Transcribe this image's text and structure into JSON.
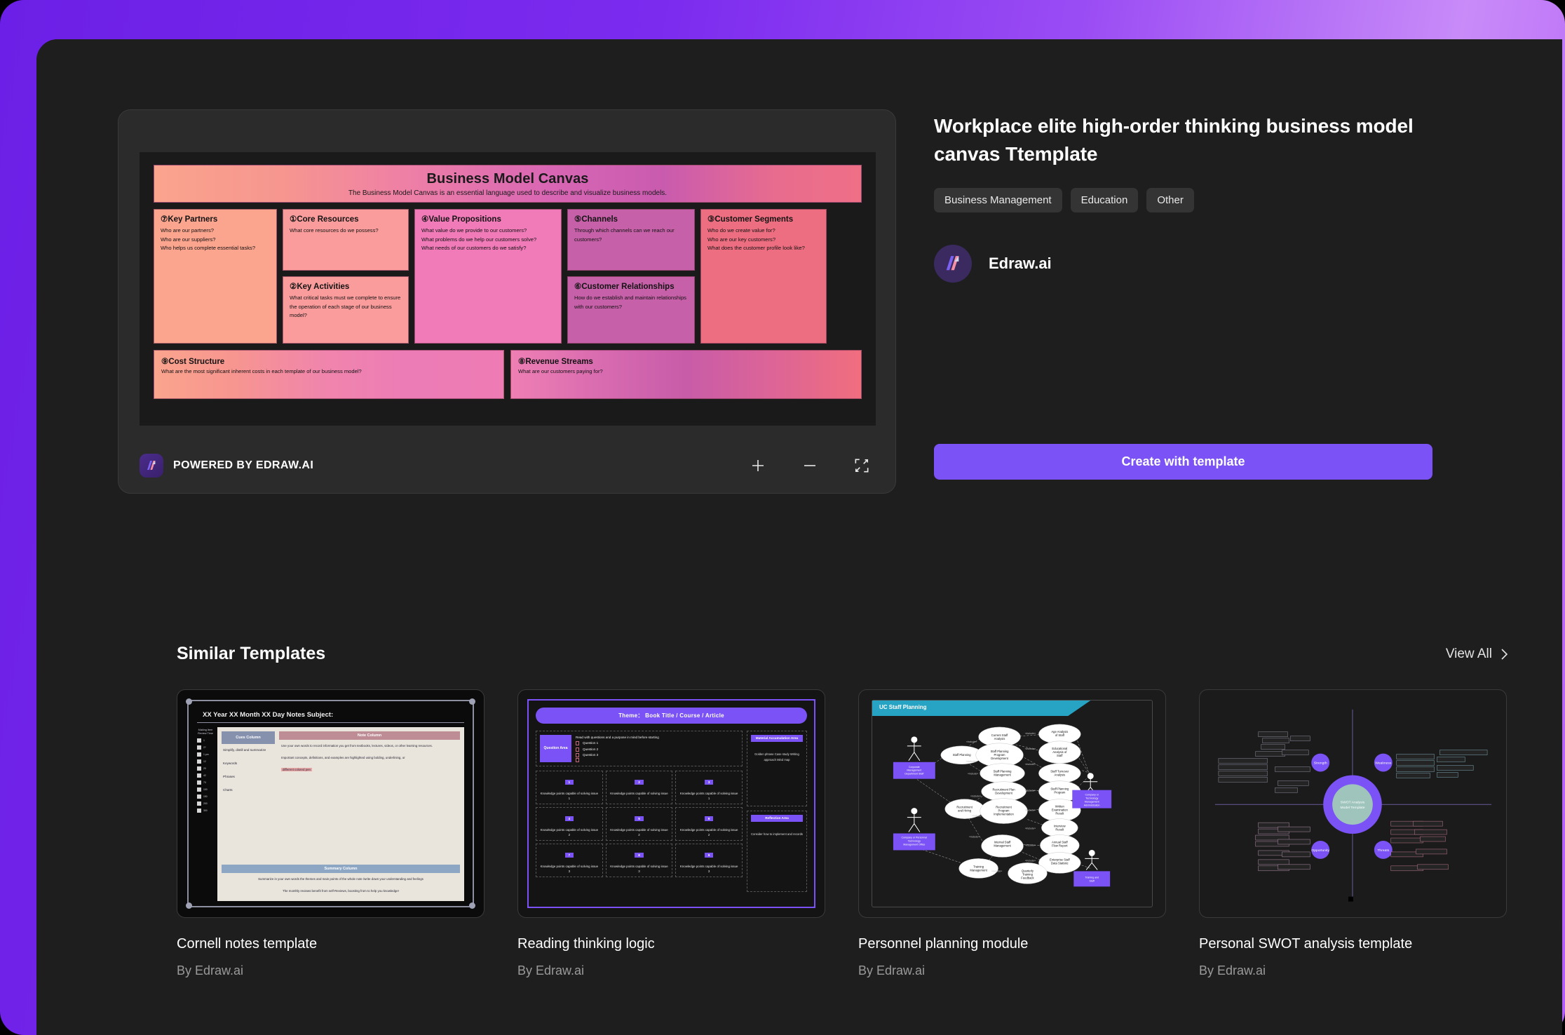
{
  "template": {
    "title": "Workplace elite high-order thinking business model canvas Ttemplate",
    "tags": [
      "Business Management",
      "Education",
      "Other"
    ],
    "author": "Edraw.ai",
    "cta_label": "Create with template"
  },
  "preview": {
    "watermark": "POWERED BY EDRAW.AI",
    "zoom_in": "+",
    "zoom_out": "−",
    "fullscreen_label": "Fullscreen"
  },
  "canvas": {
    "header_title": "Business Model Canvas",
    "header_subtitle": "The Business Model Canvas is an essential language used to describe and visualize business models.",
    "blocks": [
      {
        "num": "⑦",
        "title": "Key Partners",
        "lines": [
          "Who are our partners?",
          "Who are our suppliers?",
          "Who helps us complete essential tasks?"
        ]
      },
      {
        "num": "①",
        "title": "Core Resources",
        "lines": [
          "What core resources do we possess?"
        ]
      },
      {
        "num": "②",
        "title": "Key Activities",
        "lines": [
          "What critical tasks must we complete to ensure the operation of each stage of our business model?"
        ]
      },
      {
        "num": "④",
        "title": "Value Propositions",
        "lines": [
          "What value do we provide to our customers?",
          "What problems do we help our customers solve?",
          "What needs of our customers do we satisfy?"
        ]
      },
      {
        "num": "⑤",
        "title": "Channels",
        "lines": [
          "Through which channels can we reach our customers?"
        ]
      },
      {
        "num": "⑥",
        "title": "Customer Relationships",
        "lines": [
          "How do we establish and maintain relationships with our customers?"
        ]
      },
      {
        "num": "③",
        "title": "Customer Segments",
        "lines": [
          "Who do we create value for?",
          "Who are our key customers?",
          "What does the customer profile look like?"
        ]
      },
      {
        "num": "⑨",
        "title": "Cost Structure",
        "lines": [
          "What are the most significant inherent costs in each template of our business model?"
        ]
      },
      {
        "num": "⑧",
        "title": "Revenue Streams",
        "lines": [
          "What are our customers paying for?"
        ]
      }
    ]
  },
  "similar": {
    "heading": "Similar Templates",
    "view_all": "View All",
    "cards": [
      {
        "title": "Cornell notes template",
        "by": "By Edraw.ai"
      },
      {
        "title": "Reading thinking logic",
        "by": "By Edraw.ai"
      },
      {
        "title": "Personnel planning module",
        "by": "By Edraw.ai"
      },
      {
        "title": "Personal SWOT analysis template",
        "by": "By Edraw.ai"
      }
    ]
  },
  "thumb_cornell": {
    "header": "XX Year XX Month XX Day     Notes Subject:",
    "rail_label": "Making Item Review Time",
    "rail_rows": [
      "1",
      "2?",
      "1 pm",
      "12",
      "20",
      "42",
      "70",
      "100",
      "150",
      "200",
      "300"
    ],
    "cues_header": "Cues Column",
    "cues_body": "Simplify, distill and summarize",
    "cues_items": [
      "Keywords",
      "Phrases",
      "Charts"
    ],
    "note_header": "Note Column",
    "note_body": "Use your own words to record information you get from textbooks, lectures, videos, or other learning resources.",
    "note_body2": "Important concepts, definitions, and examples are highlighted using bolding, underlining, or",
    "note_hl": "different colored pen",
    "summary_header": "Summary Column",
    "summary_body": "Summarize in your own words the themes and main points of the whole note /write down your understanding and feelings",
    "summary_note": "The monthly reviews benefit from self-Reviews, boosting from to help you knowledge!"
  },
  "thumb_reading": {
    "theme": "Theme： Book Title / Course / Article",
    "question_area": "Question Area",
    "read_prompt": "Read with questions and a purpose in mind before starting",
    "questions": [
      "Question 1",
      "Question 2",
      "Question 3"
    ],
    "cells": [
      {
        "num": "1",
        "text": "Knowledge points capable of solving issue 1"
      },
      {
        "num": "2",
        "text": "Knowledge points capable of solving issue 1"
      },
      {
        "num": "3",
        "text": "Knowledge points capable of solving issue 1"
      },
      {
        "num": "4",
        "text": "Knowledge points capable of solving issue 2"
      },
      {
        "num": "5",
        "text": "Knowledge points capable of solving issue 2"
      },
      {
        "num": "6",
        "text": "Knowledge points capable of solving issue 2"
      },
      {
        "num": "7",
        "text": "Knowledge points capable of solving issue 3"
      },
      {
        "num": "8",
        "text": "Knowledge points capable of solving issue 3"
      },
      {
        "num": "9",
        "text": "Knowledge points capable of solving issue 3"
      }
    ],
    "material_header": "Material Accumulation Area",
    "material_body": "Golden phrase Case study Writing approach Mind map",
    "reflection_header": "Reflection Area",
    "reflection_body": "Consider how to implement and records"
  },
  "thumb_usecase": {
    "title": "UC Staff Planning",
    "actors": [
      "Corporate Management Department Staff",
      "Company or Personnel Technology Management Office",
      "Training and Staff"
    ],
    "usecases": [
      "Staff Planning",
      "Current Staff Analysis",
      "Age Analysis of Staff",
      "Staff Planning Program Development",
      "Educational Analysis of Staff",
      "Staff Planning Management",
      "Staff Turnover Analysis",
      "Recruitment and Hiring",
      "Recruitment Plan Development",
      "Staff Planning Program",
      "Recruitment Program Implementation",
      "Written Examination Result",
      "Interview Result",
      "Internal Staff Management",
      "Annual Staff Flow Report",
      "Enterprise Staff Data Statistic",
      "Training Management",
      "Quarterly Training Feedback"
    ],
    "relation_label": "«include»"
  },
  "thumb_swot": {
    "center": "SWOT Analysis Model Template",
    "quadrants": [
      "Strength",
      "Weakness",
      "Opportunity",
      "Threats"
    ]
  },
  "colors": {
    "accent": "#7B52F5",
    "frame_gradient_start": "#6C1FE6",
    "frame_gradient_end": "#C88BF8",
    "app_background": "#1E1E1E",
    "panel_background": "#2B2B2B",
    "tag_background": "#343434"
  }
}
